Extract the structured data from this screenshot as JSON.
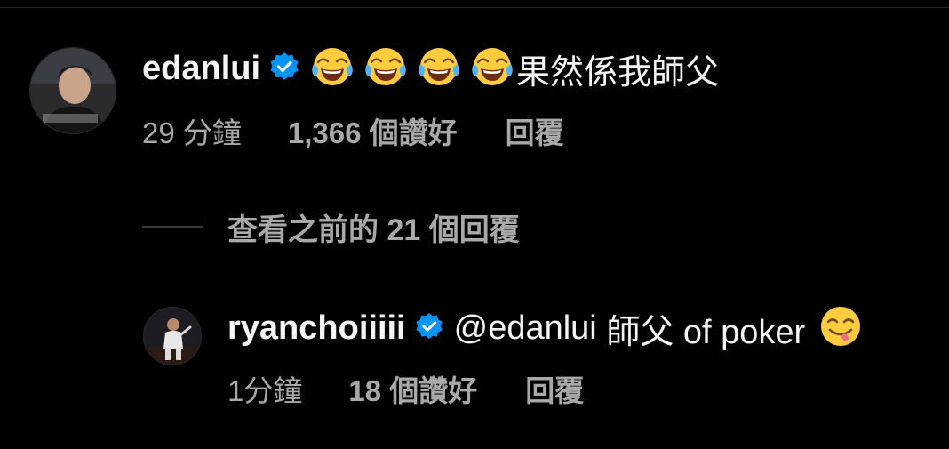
{
  "comments": [
    {
      "username": "edanlui",
      "text": "果然係我師父",
      "emoji_icons": [
        "face-with-tears-of-joy-icon",
        "face-with-tears-of-joy-icon",
        "face-with-tears-of-joy-icon",
        "face-with-tears-of-joy-icon"
      ],
      "time": "29 分鐘",
      "likes": "1,366 個讚好",
      "reply_label": "回覆"
    },
    {
      "username": "ryanchoiiiii",
      "mention": "@edanlui",
      "text": " 師父 of poker ",
      "emoji_icons": [
        "face-savoring-food-icon"
      ],
      "time": "1分鐘",
      "likes": "18 個讚好",
      "reply_label": "回覆"
    }
  ],
  "view_replies": {
    "label": "查看之前的 21 個回覆"
  },
  "colors": {
    "background": "#000000",
    "primary_text": "#f5f5f5",
    "secondary_text": "#a8a8a8",
    "verified": "#0095f6"
  }
}
